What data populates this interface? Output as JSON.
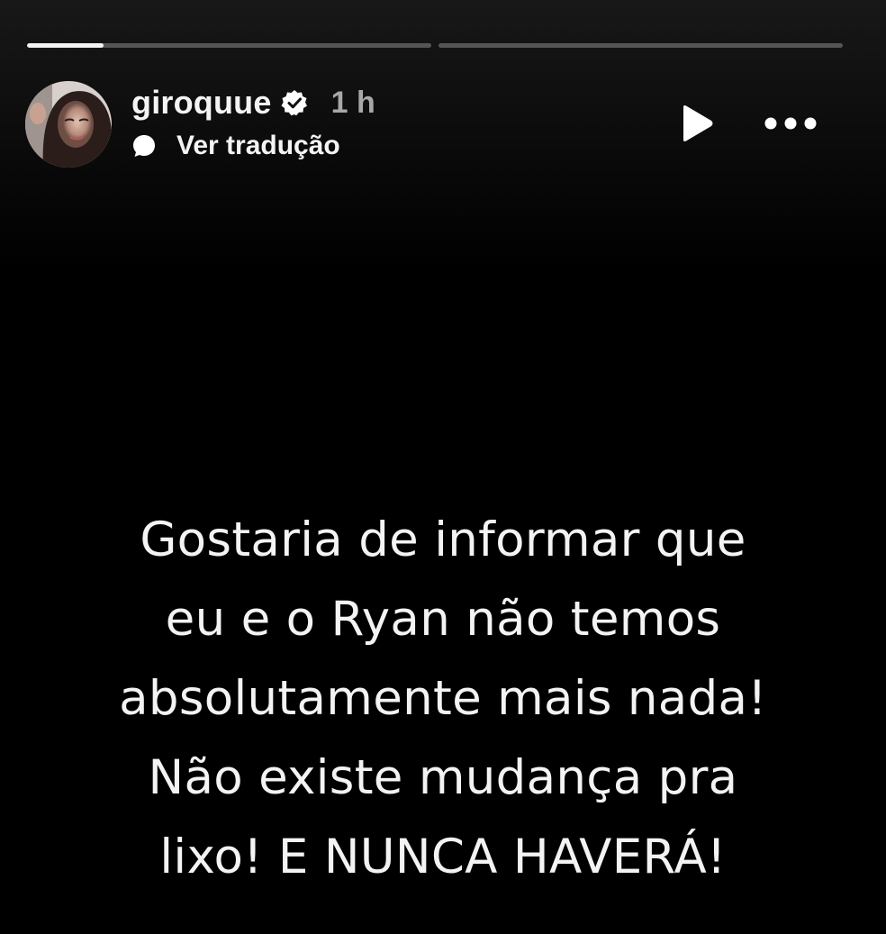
{
  "progress": {
    "segments": [
      {
        "fill": 0.19
      },
      {
        "fill": 0
      }
    ]
  },
  "header": {
    "username": "giroquue",
    "time_ago": "1 h",
    "translate_label": "Ver tradução",
    "icons": {
      "verified": "verified-badge-icon",
      "translate": "speech-bubble-icon",
      "play": "play-icon",
      "more": "more-options-icon"
    }
  },
  "story": {
    "lines": [
      "Gostaria de informar que",
      "eu e o Ryan não temos",
      "absolutamente mais nada!",
      "Não existe mudança pra",
      "lixo! E NUNCA HAVERÁ!"
    ]
  },
  "colors": {
    "background": "#000000",
    "text": "#f3f3f3",
    "muted": "#a8a8a8",
    "progress_track": "#555555",
    "progress_fill": "#f2f2f2"
  }
}
